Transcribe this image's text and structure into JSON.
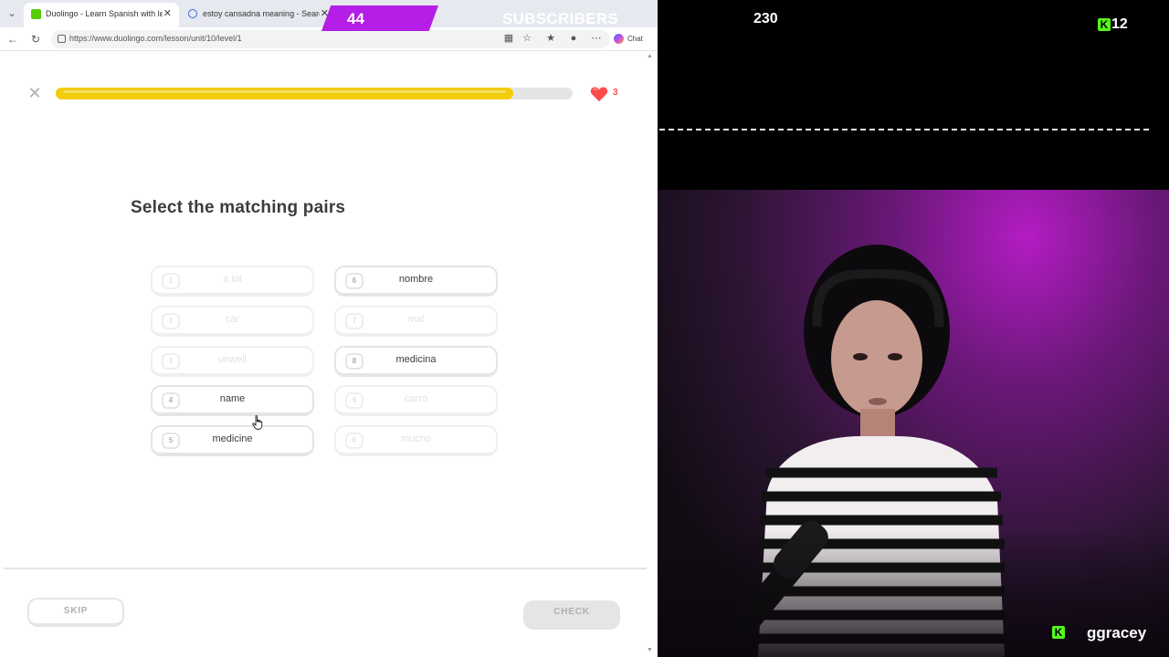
{
  "browser": {
    "tabs": [
      {
        "title": "Duolingo - Learn Spanish with lessons",
        "active": true
      },
      {
        "title": "estoy cansadna meaning - Search",
        "active": false
      }
    ],
    "url": "https://www.duolingo.com/lesson/unit/10/level/1",
    "chat_label": "Chat"
  },
  "lesson": {
    "progress_percent": 88.5,
    "hearts": "3",
    "instruction": "Select the matching pairs",
    "left_tiles": [
      {
        "num": "1",
        "word": "a lot",
        "matched": true
      },
      {
        "num": "2",
        "word": "car",
        "matched": true
      },
      {
        "num": "3",
        "word": "unwell",
        "matched": true
      },
      {
        "num": "4",
        "word": "name",
        "matched": false
      },
      {
        "num": "5",
        "word": "medicine",
        "matched": false
      }
    ],
    "right_tiles": [
      {
        "num": "6",
        "word": "nombre",
        "matched": false
      },
      {
        "num": "7",
        "word": "mal",
        "matched": true
      },
      {
        "num": "8",
        "word": "medicina",
        "matched": false
      },
      {
        "num": "9",
        "word": "carro",
        "matched": true
      },
      {
        "num": "0",
        "word": "mucho",
        "matched": true
      }
    ],
    "skip_label": "SKIP",
    "check_label": "CHECK"
  },
  "overlay": {
    "subscriber_count": "44",
    "subscriber_label": "SUBSCRIBERS",
    "viewer_count": "230",
    "kick_count": "12",
    "streamer_name": "ggracey"
  },
  "colors": {
    "progress_fill": "#f2cd09",
    "heart": "#ff4b4b",
    "subscriber_banner": "#b51ee6",
    "kick_green": "#53fc18"
  }
}
